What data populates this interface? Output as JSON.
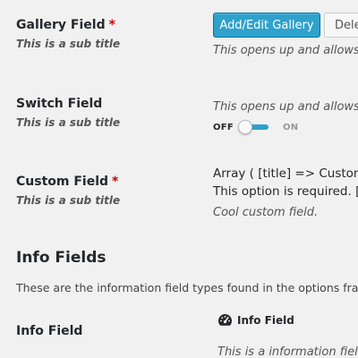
{
  "gallery_field": {
    "title": "Gallery Field",
    "required_mark": "*",
    "subtitle": "This is a sub title",
    "add_edit_button": "Add/Edit Gallery",
    "delete_button": "Dele",
    "description": "This opens up and allows y"
  },
  "switch_field": {
    "title": "Switch Field",
    "subtitle": "This is a sub title",
    "description": "This opens up and allows y",
    "off_label": "OFF",
    "on_label": "ON",
    "state": "off",
    "accent_color": "#2ea2cc"
  },
  "custom_field": {
    "title": "Custom Field",
    "required_mark": "*",
    "subtitle": "This is a sub title",
    "line1": "Array ( [title] => Custom F",
    "line2": "This option is required. [c",
    "description": "Cool custom field."
  },
  "info_section": {
    "title": "Info Fields",
    "description": "These are the information field types found in the options fram"
  },
  "info_field": {
    "title": "Info Field",
    "box_icon": "dashboard-icon",
    "box_title": "Info Field",
    "box_text": "This is a information field"
  },
  "colors": {
    "primary_button": "#2ea2cc",
    "required": "#cc0000",
    "background": "#f1f1f1"
  }
}
